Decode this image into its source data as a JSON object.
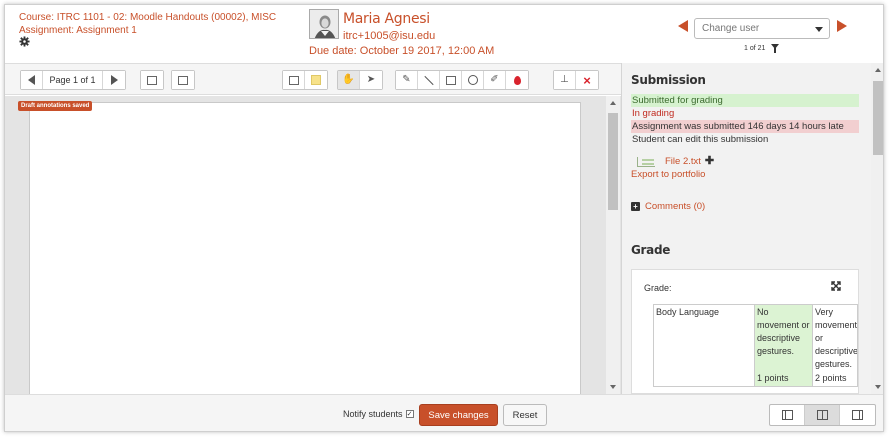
{
  "header": {
    "course": "Course: ITRC 1101 - 02: Moodle Handouts (00002), MISC",
    "assignment": "Assignment: Assignment 1",
    "user_name": "Maria Agnesi",
    "user_email": "itrc+1005@isu.edu",
    "due_date": "Due date: October 19 2017, 12:00 AM",
    "change_user_placeholder": "Change user",
    "pager": "1 of 21"
  },
  "toolbar": {
    "page_label": "Page 1 of 1"
  },
  "document": {
    "draft_badge": "Draft annotations saved"
  },
  "submission": {
    "title": "Submission",
    "status_submitted": "Submitted for grading",
    "status_grading": "In grading",
    "status_late": "Assignment was submitted 146 days 14 hours late",
    "status_edit": "Student can edit this submission",
    "file_name": "File 2.txt",
    "export_label": "Export to portfolio",
    "comments_label": "Comments (0)"
  },
  "grade": {
    "title": "Grade",
    "label": "Grade:",
    "criterion": "Body Language",
    "level1_text": "No movement or descriptive gestures.",
    "level1_points": "1 points",
    "level2_text": "Very movement or descriptive gestures.",
    "level2_points": "2 points"
  },
  "footer": {
    "notify_label": "Notify students",
    "save_label": "Save changes",
    "reset_label": "Reset"
  },
  "colors": {
    "accent": "#c8502a",
    "submitted_bg": "#d6f2cf",
    "late_bg": "#f2cfd0"
  }
}
